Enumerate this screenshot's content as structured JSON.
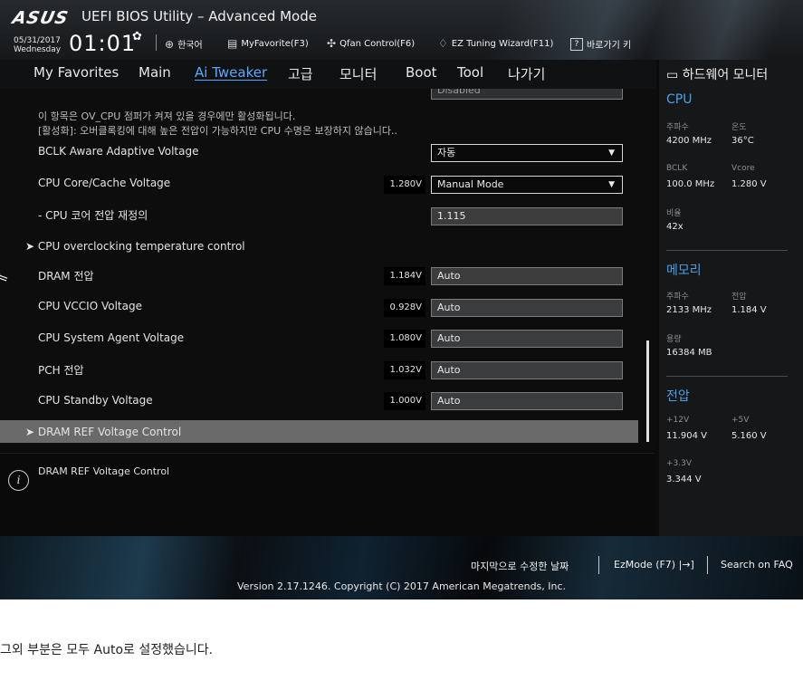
{
  "header": {
    "logo": "ASUS",
    "title": "UEFI BIOS Utility – Advanced Mode",
    "date": "05/31/2017",
    "weekday": "Wednesday",
    "time": "01:01",
    "language": "한국어",
    "my_favorite": "MyFavorite(F3)",
    "qfan": "Qfan Control(F6)",
    "ez_tuning": "EZ Tuning Wizard(F11)",
    "shortcut": "바로가기 키",
    "icons": {
      "settings": "gear-icon",
      "language": "globe-icon",
      "favorite": "favorite-icon",
      "qfan": "fan-icon",
      "ez_tuning": "bulb-icon",
      "shortcut": "help-key-icon"
    }
  },
  "tabs": [
    {
      "label": "My Favorites"
    },
    {
      "label": "Main"
    },
    {
      "label": "Ai Tweaker",
      "active": true
    },
    {
      "label": "고급"
    },
    {
      "label": "모니터"
    },
    {
      "label": "Boot"
    },
    {
      "label": "Tool"
    },
    {
      "label": "나가기"
    }
  ],
  "main": {
    "partial_top_field": "Disabled",
    "note1": "이 항목은 OV_CPU 점퍼가 켜져 있을 경우에만 활성화됩니다.",
    "note2": "[활성화]: 오버클록킹에 대해 높은 전압이 가능하지만 CPU 수명은 보장하지 않습니다..",
    "rows": [
      {
        "label": "BCLK Aware Adaptive Voltage",
        "value": "",
        "setting": "자동"
      },
      {
        "label": "CPU Core/Cache Voltage",
        "value": "1.280V",
        "setting": "Manual Mode"
      },
      {
        "label": "- CPU 코어 전압 재정의",
        "value": "",
        "setting": "1.115"
      },
      {
        "label": "CPU overclocking temperature control",
        "value": "",
        "setting": ""
      },
      {
        "label": "DRAM 전압",
        "value": "1.184V",
        "setting": "Auto"
      },
      {
        "label": "CPU VCCIO Voltage",
        "value": "0.928V",
        "setting": "Auto"
      },
      {
        "label": "CPU System Agent Voltage",
        "value": "1.080V",
        "setting": "Auto"
      },
      {
        "label": "PCH 전압",
        "value": "1.032V",
        "setting": "Auto"
      },
      {
        "label": "CPU Standby Voltage",
        "value": "1.000V",
        "setting": "Auto"
      },
      {
        "label": "DRAM REF Voltage Control",
        "value": "",
        "setting": ""
      }
    ]
  },
  "help": {
    "text": "DRAM REF Voltage Control"
  },
  "monitor": {
    "title": "하드웨어 모니터",
    "cpu": {
      "section": "CPU",
      "freq_label": "주파수",
      "freq": "4200 MHz",
      "temp_label": "온도",
      "temp": "36°C",
      "bclk_label": "BCLK",
      "bclk": "100.0 MHz",
      "vcore_label": "Vcore",
      "vcore": "1.280 V",
      "ratio_label": "비율",
      "ratio": "42x"
    },
    "memory": {
      "section": "메모리",
      "freq_label": "주파수",
      "freq": "2133 MHz",
      "volt_label": "전압",
      "volt": "1.184 V",
      "cap_label": "용량",
      "cap": "16384 MB"
    },
    "voltage": {
      "section": "전압",
      "v12_label": "+12V",
      "v12": "11.904 V",
      "v5_label": "+5V",
      "v5": "5.160 V",
      "v33_label": "+3.3V",
      "v33": "3.344 V"
    }
  },
  "footer": {
    "last_modified": "마지막으로 수정한 날짜",
    "ezmode": "EzMode (F7)",
    "search": "Search on FAQ",
    "version": "Version 2.17.1246. Copyright (C) 2017 American Megatrends, Inc."
  },
  "caption": "그외 부분은 모두 Auto로 설정했습니다."
}
